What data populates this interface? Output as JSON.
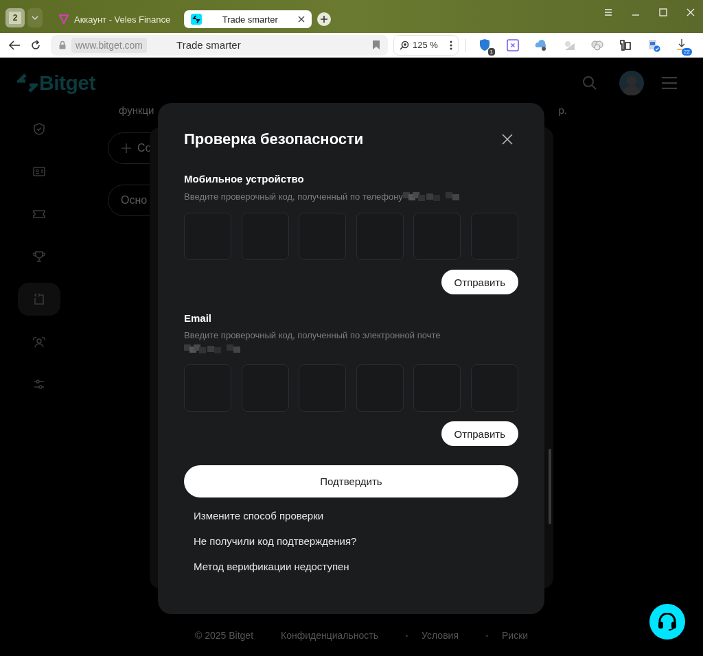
{
  "browser": {
    "tab_count": "2",
    "tabs": [
      {
        "title": "Аккаунт - Veles Finance",
        "selected": false,
        "kind": "veles"
      },
      {
        "title": "Trade smarter",
        "selected": true,
        "kind": "bitget"
      }
    ],
    "address": "www.bitget.com",
    "page_title": "Trade smarter",
    "zoom": "125 %",
    "extensions": [
      {
        "kind": "shield",
        "badge": "1"
      },
      {
        "kind": "cross-square"
      },
      {
        "kind": "cloud"
      },
      {
        "kind": "sun"
      },
      {
        "kind": "blob"
      },
      {
        "kind": "tshirt"
      },
      {
        "kind": "doc-check"
      },
      {
        "kind": "download",
        "badge": "22"
      }
    ]
  },
  "site": {
    "logo": "Bitget",
    "sidebar": [
      {
        "kind": "shield",
        "selected": false
      },
      {
        "kind": "id-card",
        "selected": false
      },
      {
        "kind": "ticket",
        "selected": false
      },
      {
        "kind": "trophy",
        "selected": false
      },
      {
        "kind": "api",
        "selected": true
      },
      {
        "kind": "people",
        "selected": false
      },
      {
        "kind": "sliders",
        "selected": false
      }
    ],
    "behind_texts": [
      "функци",
      "р."
    ],
    "behind_buttons": [
      {
        "label": "Со",
        "kind": "add"
      },
      {
        "label": "Осно",
        "kind": "plain"
      }
    ],
    "footer": [
      "© 2025 Bitget",
      "Конфиденциальность",
      "Условия",
      "Риски"
    ]
  },
  "modal": {
    "title": "Проверка безопасности",
    "sections": [
      {
        "heading": "Мобильное устройство",
        "hint": "Введите проверочный код, полученный по телефону",
        "send": "Отправить",
        "redaction_wraps": false
      },
      {
        "heading": "Email",
        "hint": "Введите проверочный код, полученный по электронной почте",
        "send": "Отправить",
        "redaction_wraps": true
      }
    ],
    "confirm": "Подтвердить",
    "links": [
      "Измените способ проверки",
      "Не получили код подтверждения?",
      "Метод верификации недоступен"
    ]
  }
}
